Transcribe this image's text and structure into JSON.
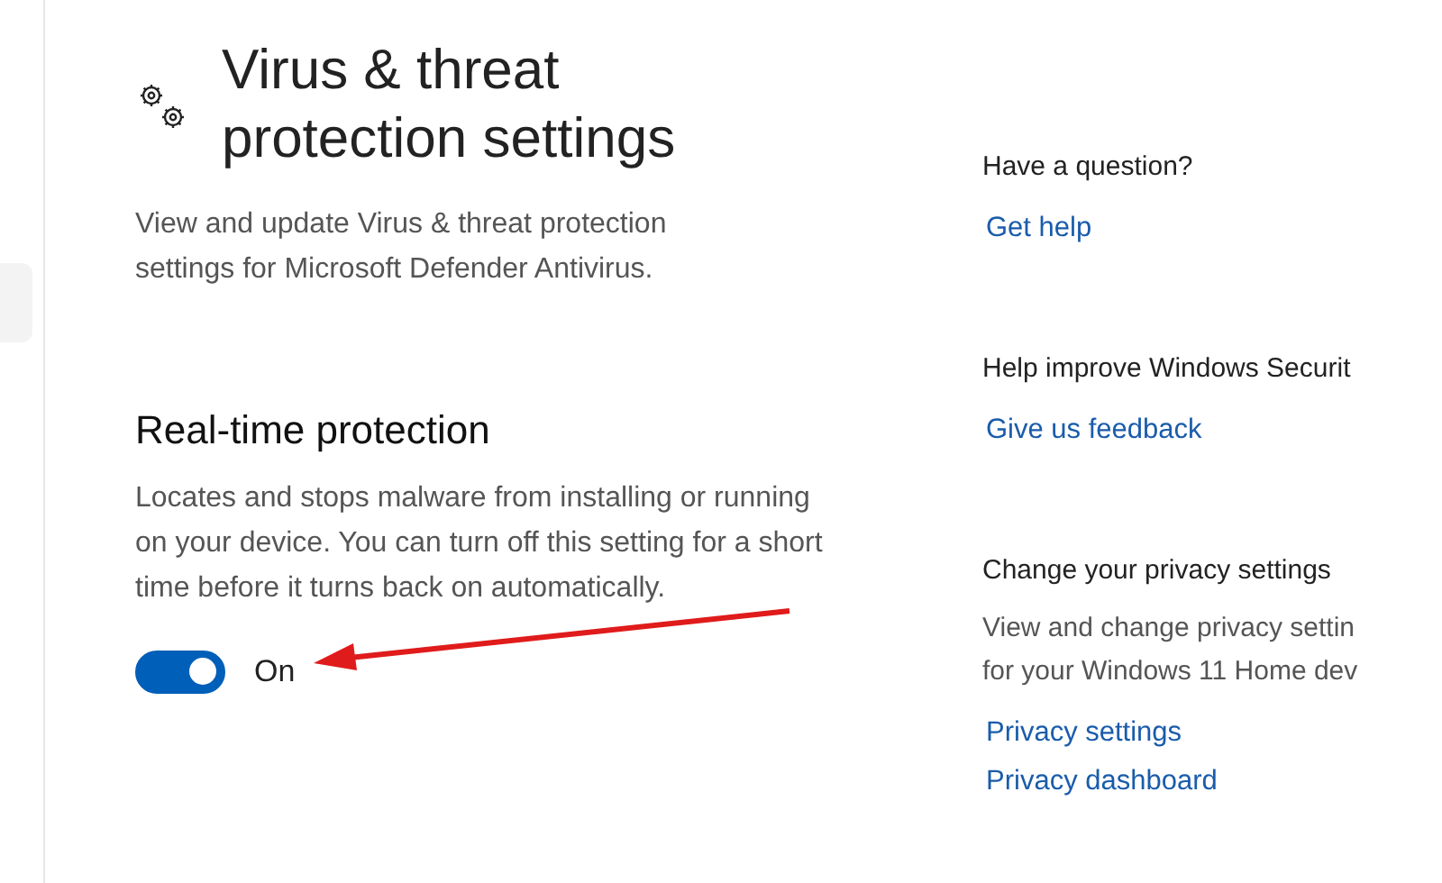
{
  "sidebar": {
    "items": [
      {
        "selected": true
      }
    ]
  },
  "header": {
    "title_lines": [
      "Virus & threat",
      "protection settings"
    ],
    "description": "View and update Virus & threat protection settings for Microsoft Defender Antivirus."
  },
  "section": {
    "title": "Real-time protection",
    "description": "Locates and stops malware from installing or running on your device. You can turn off this setting for a short time before it turns back on automatically.",
    "toggle": {
      "on": true,
      "label": "On"
    }
  },
  "side_panel": [
    {
      "heading": "Have a question?",
      "links": [
        "Get help"
      ]
    },
    {
      "heading": "Help improve Windows Securit",
      "links": [
        "Give us feedback"
      ]
    },
    {
      "heading": "Change your privacy settings",
      "lines": [
        "View and change privacy settin",
        "for your Windows 11 Home dev"
      ],
      "links": [
        "Privacy settings",
        "Privacy dashboard"
      ]
    }
  ]
}
